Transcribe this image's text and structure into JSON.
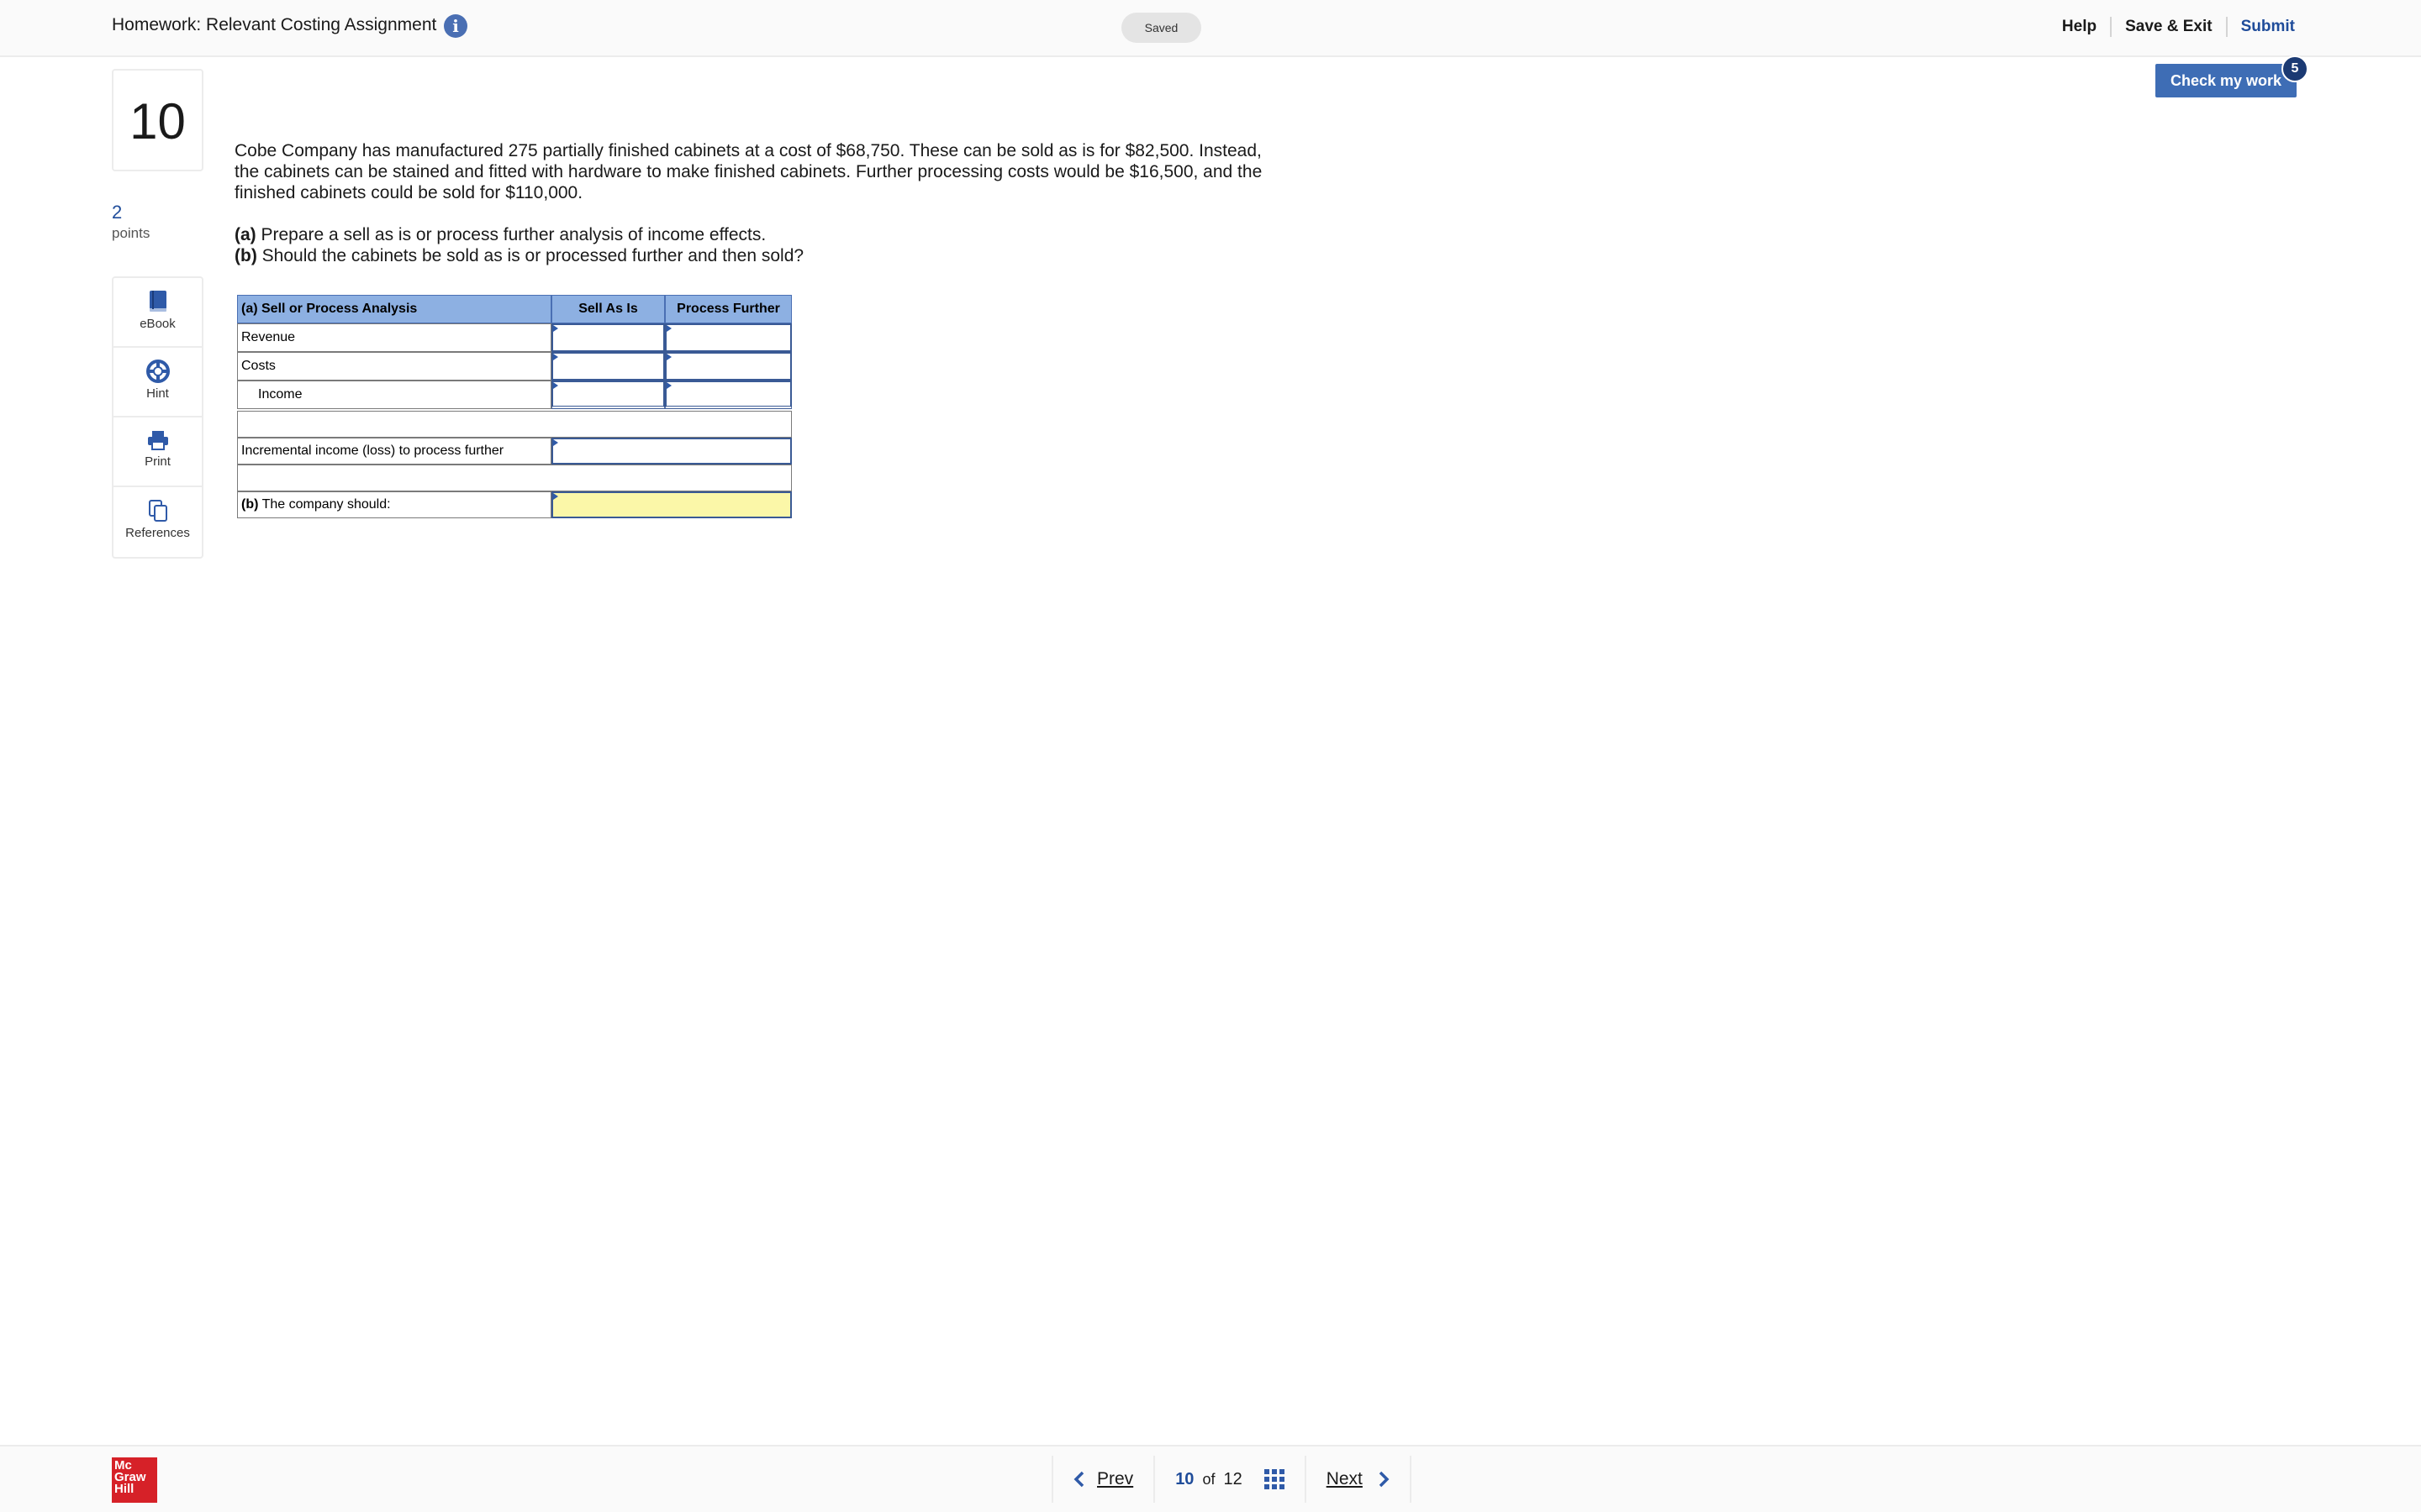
{
  "header": {
    "title": "Homework: Relevant Costing Assignment",
    "info_glyph": "i",
    "saved_label": "Saved",
    "help_label": "Help",
    "save_exit_label": "Save & Exit",
    "submit_label": "Submit"
  },
  "question": {
    "number": "10",
    "points_value": "2",
    "points_label": "points",
    "text": "Cobe Company has manufactured 275 partially finished cabinets at a cost of $68,750. These can be sold as is for $82,500. Instead, the cabinets can be stained and fitted with hardware to make finished cabinets. Further processing costs would be $16,500, and the finished cabinets could be sold for $110,000.",
    "part_a_prefix": "(a)",
    "part_a_text": " Prepare a sell as is or process further analysis of income effects.",
    "part_b_prefix": "(b)",
    "part_b_text": " Should the cabinets be sold as is or processed further and then sold?"
  },
  "tools": [
    {
      "icon": "ebook-icon",
      "label": "eBook"
    },
    {
      "icon": "hint-icon",
      "label": "Hint"
    },
    {
      "icon": "print-icon",
      "label": "Print"
    },
    {
      "icon": "references-icon",
      "label": "References"
    }
  ],
  "table": {
    "header_label": "(a) Sell or Process Analysis",
    "col_sell": "Sell As Is",
    "col_process": "Process Further",
    "row_revenue": "Revenue",
    "row_costs": "Costs",
    "row_income": "Income",
    "row_incremental": "Incremental income (loss) to process further",
    "row_company_prefix": "(b)",
    "row_company_text": " The company should:"
  },
  "check_work": {
    "label": "Check my work",
    "badge": "5"
  },
  "footer": {
    "logo_line1": "Mc",
    "logo_line2": "Graw",
    "logo_line3": "Hill",
    "prev_label": "Prev",
    "current_page": "10",
    "of_label": "of",
    "total_pages": "12",
    "next_label": "Next"
  },
  "colors": {
    "accent": "#3e6db5",
    "table_header": "#8db0e2",
    "highlight_input": "#fbf7a8",
    "brand_red": "#d62128"
  }
}
